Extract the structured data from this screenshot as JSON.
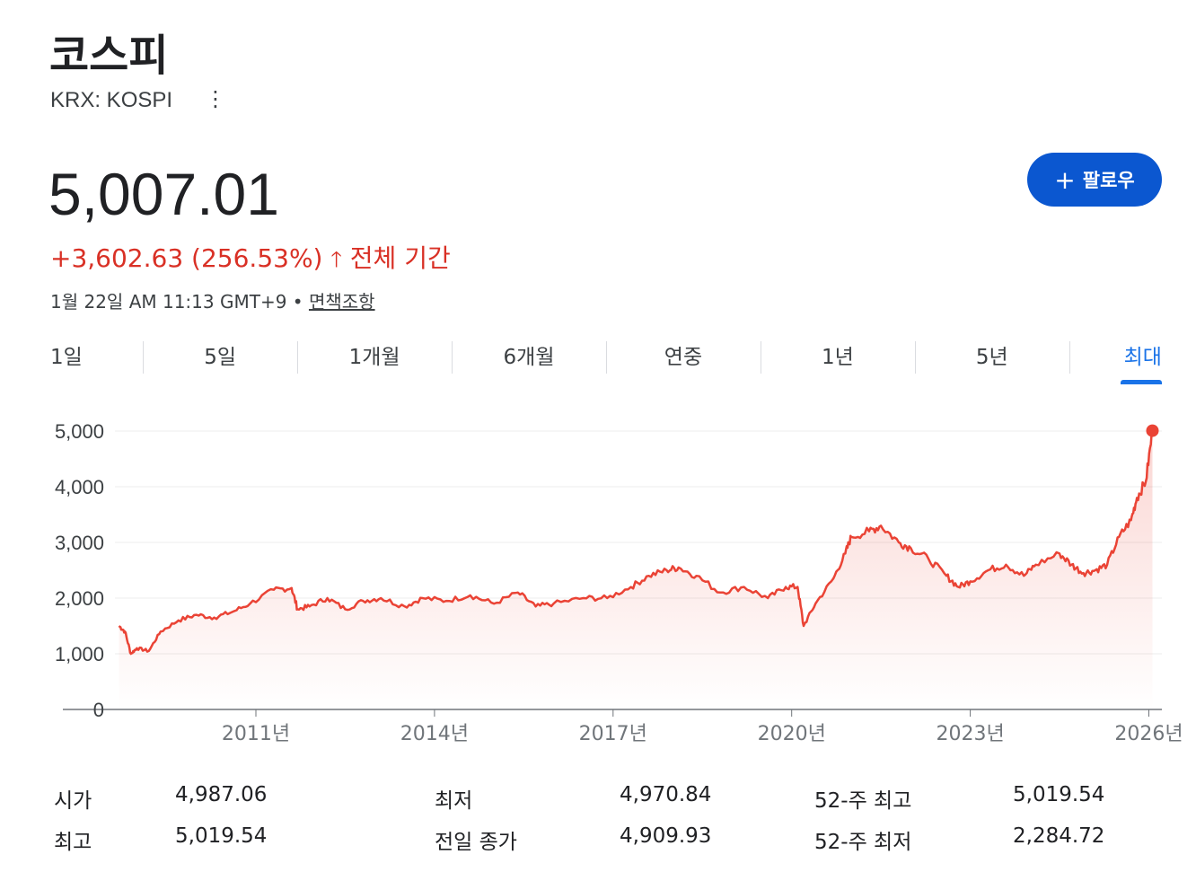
{
  "header": {
    "title": "코스피",
    "ticker": "KRX: KOSPI",
    "more_icon": "⋮",
    "price": "5,007.01",
    "change": "+3,602.63 (256.53%)",
    "arrow": "🡑",
    "period": "전체 기간",
    "time": "1월 22일 AM 11:13 GMT+9 • ",
    "disclaimer": "면책조항",
    "follow_plus": "+",
    "follow": "팔로우"
  },
  "tabs": [
    "1일",
    "5일",
    "1개월",
    "6개월",
    "연중",
    "1년",
    "5년",
    "최대"
  ],
  "active_tab": "최대",
  "colors": {
    "line": "#ea4335",
    "accent": "#1a73e8",
    "button": "#0b57d0"
  },
  "chart_data": {
    "type": "area",
    "title": "",
    "xlabel": "",
    "ylabel": "",
    "ylim": [
      0,
      5000
    ],
    "yticks": [
      0,
      1000,
      2000,
      3000,
      4000,
      5000
    ],
    "ytick_labels": [
      "0",
      "1,000",
      "2,000",
      "3,000",
      "4,000",
      "5,000"
    ],
    "xticks": [
      2011,
      2014,
      2017,
      2020,
      2023,
      2026
    ],
    "xtick_labels": [
      "2011년",
      "2014년",
      "2017년",
      "2020년",
      "2023년",
      "2026년"
    ],
    "xlim": [
      2008.5,
      2026.15
    ],
    "series": [
      {
        "name": "KOSPI",
        "x": [
          2008.7,
          2008.8,
          2008.9,
          2009.0,
          2009.2,
          2009.4,
          2009.7,
          2010.0,
          2010.3,
          2010.6,
          2010.9,
          2011.3,
          2011.6,
          2011.7,
          2011.9,
          2012.2,
          2012.5,
          2012.8,
          2013.1,
          2013.5,
          2013.8,
          2014.2,
          2014.6,
          2015.0,
          2015.4,
          2015.7,
          2016.0,
          2016.5,
          2016.9,
          2017.3,
          2017.6,
          2017.9,
          2018.1,
          2018.4,
          2018.8,
          2019.2,
          2019.6,
          2019.9,
          2020.1,
          2020.2,
          2020.4,
          2020.7,
          2020.9,
          2021.0,
          2021.3,
          2021.5,
          2021.8,
          2022.0,
          2022.3,
          2022.6,
          2022.8,
          2023.0,
          2023.3,
          2023.6,
          2023.9,
          2024.1,
          2024.5,
          2024.7,
          2024.9,
          2025.1,
          2025.3,
          2025.5,
          2025.7,
          2025.8,
          2025.95,
          2026.06
        ],
        "values": [
          1500,
          1400,
          1000,
          1100,
          1050,
          1400,
          1600,
          1700,
          1650,
          1750,
          1900,
          2150,
          2180,
          1800,
          1850,
          2000,
          1800,
          1950,
          2000,
          1850,
          2000,
          1950,
          2050,
          1900,
          2100,
          1850,
          1900,
          2000,
          2000,
          2200,
          2400,
          2500,
          2550,
          2400,
          2100,
          2200,
          2000,
          2200,
          2200,
          1500,
          1900,
          2350,
          2800,
          3100,
          3200,
          3300,
          3000,
          2900,
          2700,
          2400,
          2200,
          2300,
          2500,
          2600,
          2400,
          2600,
          2800,
          2600,
          2450,
          2500,
          2600,
          3100,
          3400,
          3800,
          4100,
          5007.01
        ]
      }
    ]
  },
  "stats": [
    {
      "label": "시가",
      "value": "4,987.06"
    },
    {
      "label": "최저",
      "value": "4,970.84"
    },
    {
      "label": "52-주 최고",
      "value": "5,019.54"
    },
    {
      "label": "최고",
      "value": "5,019.54"
    },
    {
      "label": "전일 종가",
      "value": "4,909.93"
    },
    {
      "label": "52-주 최저",
      "value": "2,284.72"
    }
  ]
}
